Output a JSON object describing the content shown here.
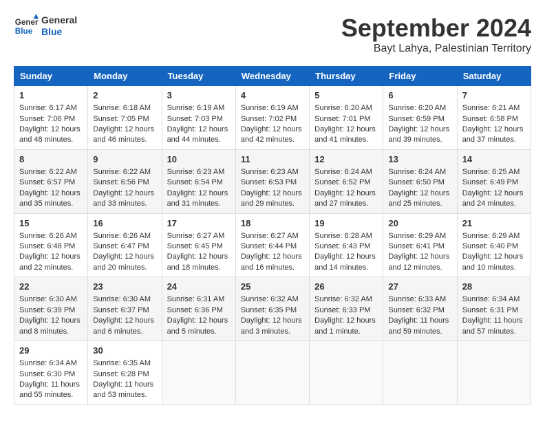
{
  "header": {
    "logo_general": "General",
    "logo_blue": "Blue",
    "month_title": "September 2024",
    "location": "Bayt Lahya, Palestinian Territory"
  },
  "days_of_week": [
    "Sunday",
    "Monday",
    "Tuesday",
    "Wednesday",
    "Thursday",
    "Friday",
    "Saturday"
  ],
  "weeks": [
    [
      {
        "day": "1",
        "lines": [
          "Sunrise: 6:17 AM",
          "Sunset: 7:06 PM",
          "Daylight: 12 hours",
          "and 48 minutes."
        ]
      },
      {
        "day": "2",
        "lines": [
          "Sunrise: 6:18 AM",
          "Sunset: 7:05 PM",
          "Daylight: 12 hours",
          "and 46 minutes."
        ]
      },
      {
        "day": "3",
        "lines": [
          "Sunrise: 6:19 AM",
          "Sunset: 7:03 PM",
          "Daylight: 12 hours",
          "and 44 minutes."
        ]
      },
      {
        "day": "4",
        "lines": [
          "Sunrise: 6:19 AM",
          "Sunset: 7:02 PM",
          "Daylight: 12 hours",
          "and 42 minutes."
        ]
      },
      {
        "day": "5",
        "lines": [
          "Sunrise: 6:20 AM",
          "Sunset: 7:01 PM",
          "Daylight: 12 hours",
          "and 41 minutes."
        ]
      },
      {
        "day": "6",
        "lines": [
          "Sunrise: 6:20 AM",
          "Sunset: 6:59 PM",
          "Daylight: 12 hours",
          "and 39 minutes."
        ]
      },
      {
        "day": "7",
        "lines": [
          "Sunrise: 6:21 AM",
          "Sunset: 6:58 PM",
          "Daylight: 12 hours",
          "and 37 minutes."
        ]
      }
    ],
    [
      {
        "day": "8",
        "lines": [
          "Sunrise: 6:22 AM",
          "Sunset: 6:57 PM",
          "Daylight: 12 hours",
          "and 35 minutes."
        ]
      },
      {
        "day": "9",
        "lines": [
          "Sunrise: 6:22 AM",
          "Sunset: 6:56 PM",
          "Daylight: 12 hours",
          "and 33 minutes."
        ]
      },
      {
        "day": "10",
        "lines": [
          "Sunrise: 6:23 AM",
          "Sunset: 6:54 PM",
          "Daylight: 12 hours",
          "and 31 minutes."
        ]
      },
      {
        "day": "11",
        "lines": [
          "Sunrise: 6:23 AM",
          "Sunset: 6:53 PM",
          "Daylight: 12 hours",
          "and 29 minutes."
        ]
      },
      {
        "day": "12",
        "lines": [
          "Sunrise: 6:24 AM",
          "Sunset: 6:52 PM",
          "Daylight: 12 hours",
          "and 27 minutes."
        ]
      },
      {
        "day": "13",
        "lines": [
          "Sunrise: 6:24 AM",
          "Sunset: 6:50 PM",
          "Daylight: 12 hours",
          "and 25 minutes."
        ]
      },
      {
        "day": "14",
        "lines": [
          "Sunrise: 6:25 AM",
          "Sunset: 6:49 PM",
          "Daylight: 12 hours",
          "and 24 minutes."
        ]
      }
    ],
    [
      {
        "day": "15",
        "lines": [
          "Sunrise: 6:26 AM",
          "Sunset: 6:48 PM",
          "Daylight: 12 hours",
          "and 22 minutes."
        ]
      },
      {
        "day": "16",
        "lines": [
          "Sunrise: 6:26 AM",
          "Sunset: 6:47 PM",
          "Daylight: 12 hours",
          "and 20 minutes."
        ]
      },
      {
        "day": "17",
        "lines": [
          "Sunrise: 6:27 AM",
          "Sunset: 6:45 PM",
          "Daylight: 12 hours",
          "and 18 minutes."
        ]
      },
      {
        "day": "18",
        "lines": [
          "Sunrise: 6:27 AM",
          "Sunset: 6:44 PM",
          "Daylight: 12 hours",
          "and 16 minutes."
        ]
      },
      {
        "day": "19",
        "lines": [
          "Sunrise: 6:28 AM",
          "Sunset: 6:43 PM",
          "Daylight: 12 hours",
          "and 14 minutes."
        ]
      },
      {
        "day": "20",
        "lines": [
          "Sunrise: 6:29 AM",
          "Sunset: 6:41 PM",
          "Daylight: 12 hours",
          "and 12 minutes."
        ]
      },
      {
        "day": "21",
        "lines": [
          "Sunrise: 6:29 AM",
          "Sunset: 6:40 PM",
          "Daylight: 12 hours",
          "and 10 minutes."
        ]
      }
    ],
    [
      {
        "day": "22",
        "lines": [
          "Sunrise: 6:30 AM",
          "Sunset: 6:39 PM",
          "Daylight: 12 hours",
          "and 8 minutes."
        ]
      },
      {
        "day": "23",
        "lines": [
          "Sunrise: 6:30 AM",
          "Sunset: 6:37 PM",
          "Daylight: 12 hours",
          "and 6 minutes."
        ]
      },
      {
        "day": "24",
        "lines": [
          "Sunrise: 6:31 AM",
          "Sunset: 6:36 PM",
          "Daylight: 12 hours",
          "and 5 minutes."
        ]
      },
      {
        "day": "25",
        "lines": [
          "Sunrise: 6:32 AM",
          "Sunset: 6:35 PM",
          "Daylight: 12 hours",
          "and 3 minutes."
        ]
      },
      {
        "day": "26",
        "lines": [
          "Sunrise: 6:32 AM",
          "Sunset: 6:33 PM",
          "Daylight: 12 hours",
          "and 1 minute."
        ]
      },
      {
        "day": "27",
        "lines": [
          "Sunrise: 6:33 AM",
          "Sunset: 6:32 PM",
          "Daylight: 11 hours",
          "and 59 minutes."
        ]
      },
      {
        "day": "28",
        "lines": [
          "Sunrise: 6:34 AM",
          "Sunset: 6:31 PM",
          "Daylight: 11 hours",
          "and 57 minutes."
        ]
      }
    ],
    [
      {
        "day": "29",
        "lines": [
          "Sunrise: 6:34 AM",
          "Sunset: 6:30 PM",
          "Daylight: 11 hours",
          "and 55 minutes."
        ]
      },
      {
        "day": "30",
        "lines": [
          "Sunrise: 6:35 AM",
          "Sunset: 6:28 PM",
          "Daylight: 11 hours",
          "and 53 minutes."
        ]
      },
      {
        "day": "",
        "lines": []
      },
      {
        "day": "",
        "lines": []
      },
      {
        "day": "",
        "lines": []
      },
      {
        "day": "",
        "lines": []
      },
      {
        "day": "",
        "lines": []
      }
    ]
  ]
}
